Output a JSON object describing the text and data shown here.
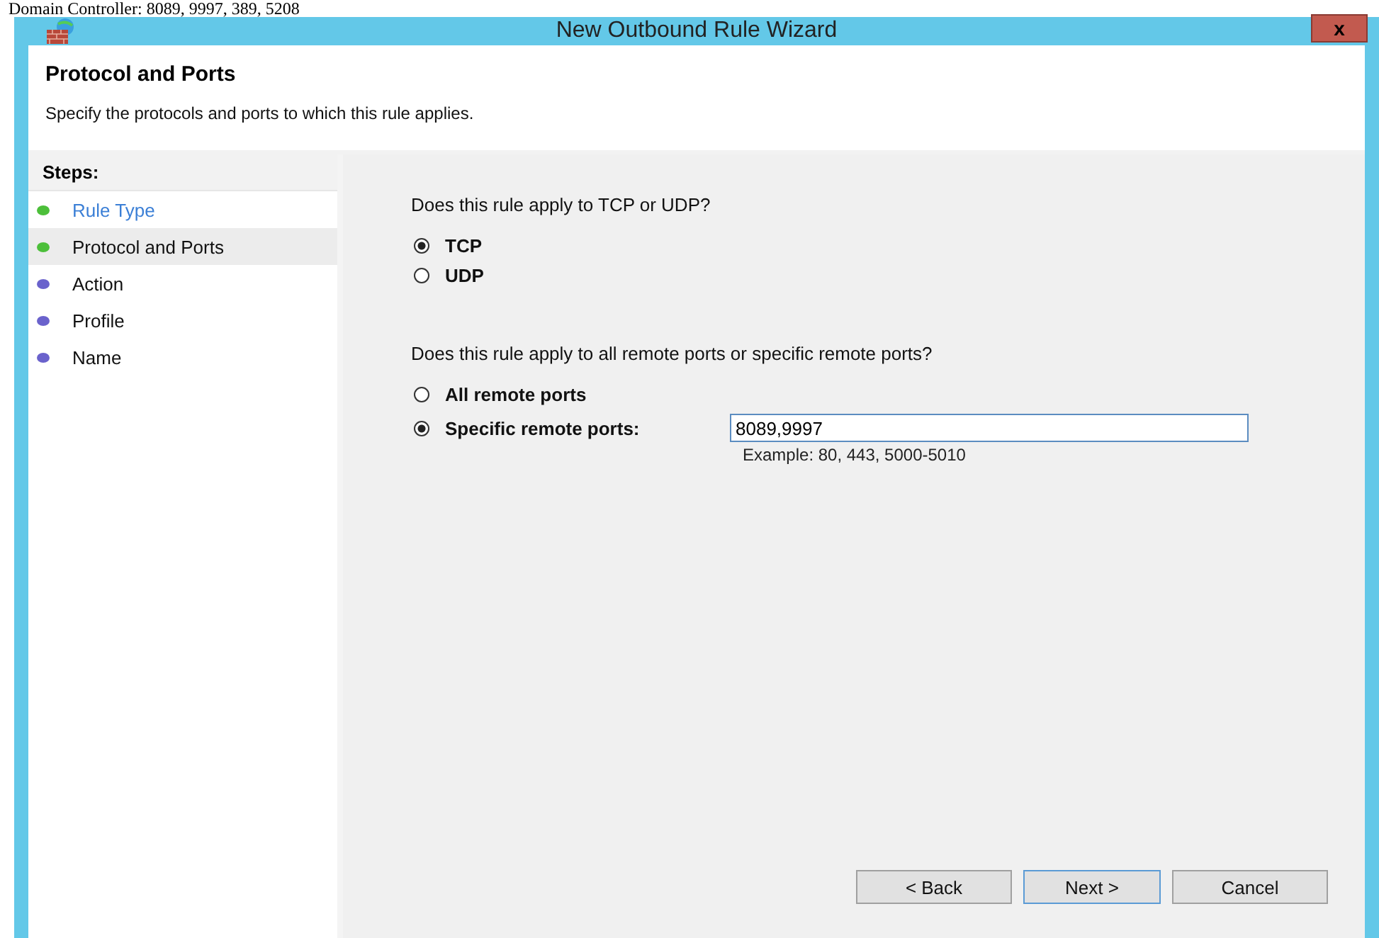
{
  "page_text": "Domain Controller: 8089, 9997, 389, 5208",
  "window": {
    "title": "New Outbound Rule Wizard",
    "close": "x"
  },
  "header": {
    "title": "Protocol and Ports",
    "subtitle": "Specify the protocols and ports to which this rule applies."
  },
  "steps": {
    "heading": "Steps:",
    "items": [
      {
        "label": "Rule Type",
        "color": "#4cbf3a",
        "selected": false,
        "link": true
      },
      {
        "label": "Protocol and Ports",
        "color": "#4cbf3a",
        "selected": true,
        "link": false
      },
      {
        "label": "Action",
        "color": "#6a62cc",
        "selected": false,
        "link": false
      },
      {
        "label": "Profile",
        "color": "#6a62cc",
        "selected": false,
        "link": false
      },
      {
        "label": "Name",
        "color": "#6a62cc",
        "selected": false,
        "link": false
      }
    ]
  },
  "protocol": {
    "question": "Does this rule apply to TCP or UDP?",
    "options": [
      {
        "label": "TCP",
        "selected": true
      },
      {
        "label": "UDP",
        "selected": false
      }
    ]
  },
  "ports": {
    "question": "Does this rule apply to all remote ports or specific remote ports?",
    "options": [
      {
        "label": "All remote ports",
        "selected": false
      },
      {
        "label": "Specific remote ports:",
        "selected": true
      }
    ],
    "value": "8089,9997",
    "example": "Example: 80, 443, 5000-5010"
  },
  "buttons": [
    {
      "label": "< Back",
      "default": false
    },
    {
      "label": "Next >",
      "default": true
    },
    {
      "label": "Cancel",
      "default": false
    }
  ]
}
